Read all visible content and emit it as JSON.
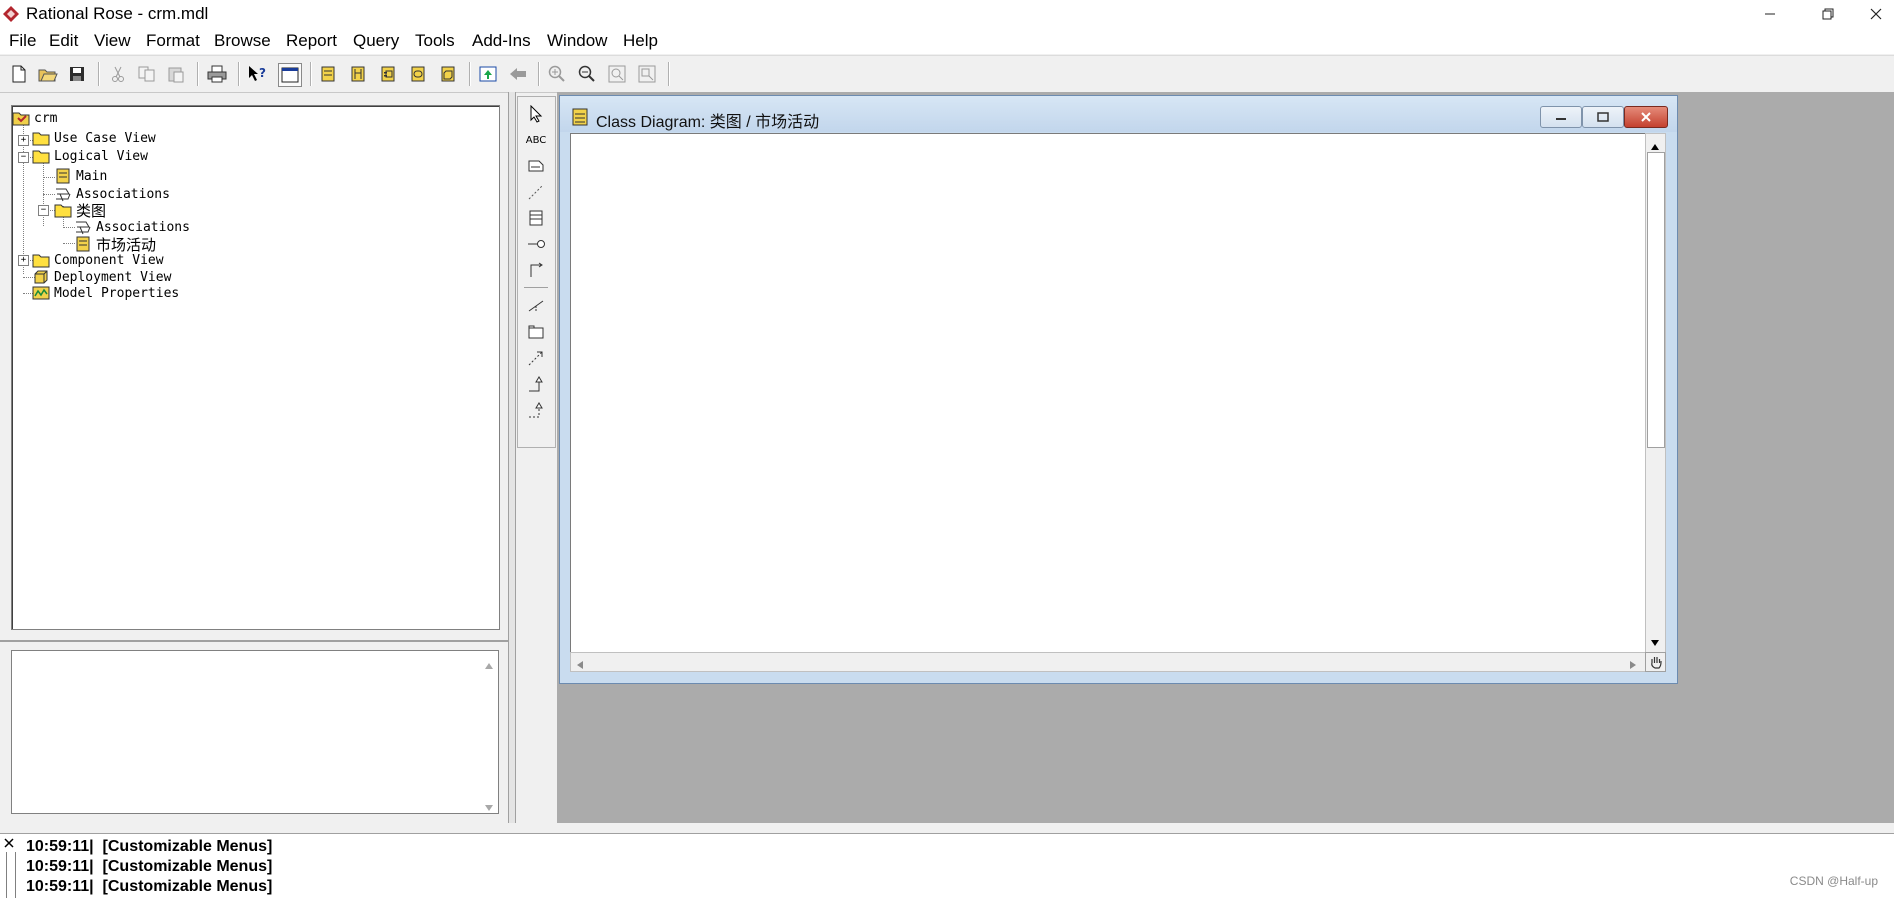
{
  "window": {
    "title": "Rational Rose - crm.mdl"
  },
  "menubar": [
    "File",
    "Edit",
    "View",
    "Format",
    "Browse",
    "Report",
    "Query",
    "Tools",
    "Add-Ins",
    "Window",
    "Help"
  ],
  "browser": {
    "root": "crm",
    "items": [
      {
        "label": "Use Case View"
      },
      {
        "label": "Logical View"
      },
      {
        "label": "Main"
      },
      {
        "label": "Associations"
      },
      {
        "label": "类图"
      },
      {
        "label": "Associations"
      },
      {
        "label": "市场活动"
      },
      {
        "label": "Component View"
      },
      {
        "label": "Deployment View"
      },
      {
        "label": "Model Properties"
      }
    ]
  },
  "toolbox": {
    "text_tool_label": "ABC"
  },
  "diagram": {
    "title": "Class Diagram: 类图 / 市场活动"
  },
  "log": [
    "10:59:11|  [Customizable Menus]",
    "10:59:11|  [Customizable Menus]",
    "10:59:11|  [Customizable Menus]"
  ],
  "watermark": "CSDN @Half-up"
}
